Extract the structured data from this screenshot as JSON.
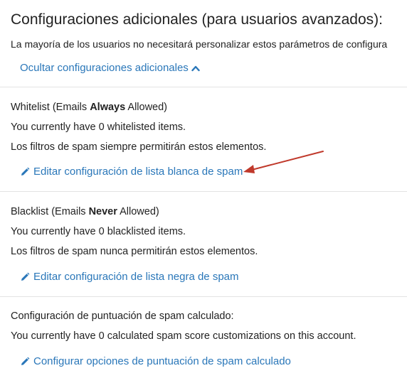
{
  "advanced": {
    "title": "Configuraciones adicionales (para usuarios avanzados):",
    "description": "La mayoría de los usuarios no necesitará personalizar estos parámetros de configura",
    "toggle_label": "Ocultar configuraciones adicionales",
    "toggle_icon": "chevron-up-icon"
  },
  "whitelist": {
    "label_prefix": "Whitelist (Emails ",
    "label_bold": "Always",
    "label_suffix": " Allowed)",
    "count_text": "You currently have 0 whitelisted items.",
    "info_text": "Los filtros de spam siempre permitirán estos elementos.",
    "edit_label": "Editar configuración de lista blanca de spam",
    "edit_icon": "pencil-icon"
  },
  "blacklist": {
    "label_prefix": "Blacklist (Emails ",
    "label_bold": "Never",
    "label_suffix": " Allowed)",
    "count_text": "You currently have 0 blacklisted items.",
    "info_text": "Los filtros de spam nunca permitirán estos elementos.",
    "edit_label": "Editar configuración de lista negra de spam",
    "edit_icon": "pencil-icon"
  },
  "score": {
    "label": "Configuración de puntuación de spam calculado:",
    "count_text": "You currently have 0 calculated spam score customizations on this account.",
    "configure_label": "Configurar opciones de puntuación de spam calculado",
    "configure_icon": "pencil-icon"
  },
  "colors": {
    "link": "#2a77b9",
    "annotation_arrow": "#c0392b",
    "divider": "#e3e3e3"
  }
}
